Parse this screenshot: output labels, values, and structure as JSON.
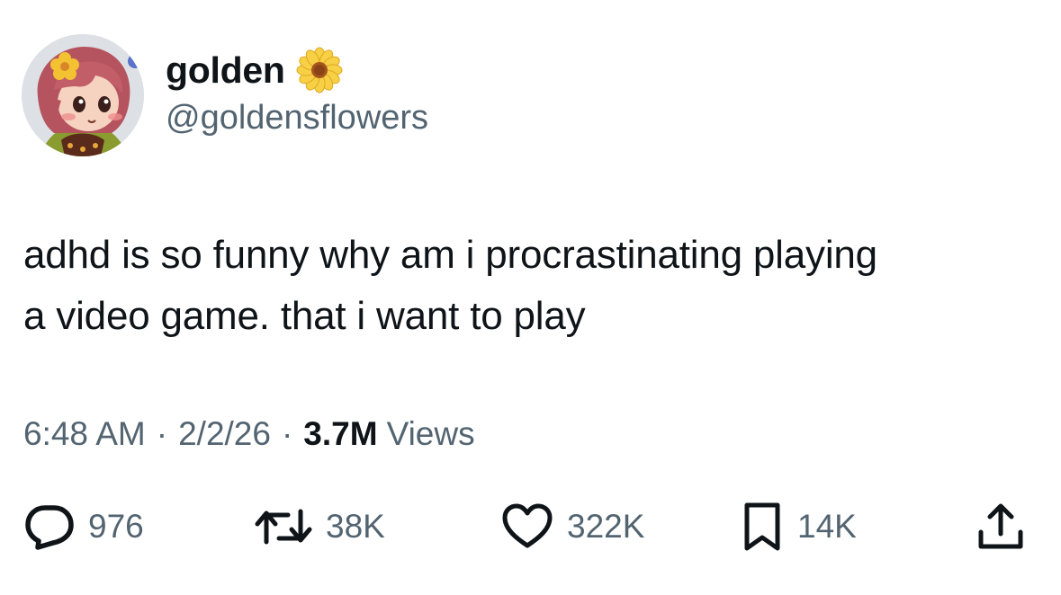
{
  "author": {
    "display_name": "golden",
    "handle": "@goldensflowers",
    "name_emoji": "sunflower-icon"
  },
  "tweet": {
    "text": "adhd is so funny why am i procrastinating playing\na video game. that i want to play"
  },
  "meta": {
    "time": "6:48 AM",
    "separator": "·",
    "date": "2/2/26",
    "views_count": "3.7M",
    "views_label": "Views"
  },
  "actions": {
    "replies": "976",
    "retweets": "38K",
    "likes": "322K",
    "bookmarks": "14K"
  },
  "colors": {
    "text_primary": "#0f1419",
    "text_secondary": "#536471",
    "background": "#ffffff"
  }
}
